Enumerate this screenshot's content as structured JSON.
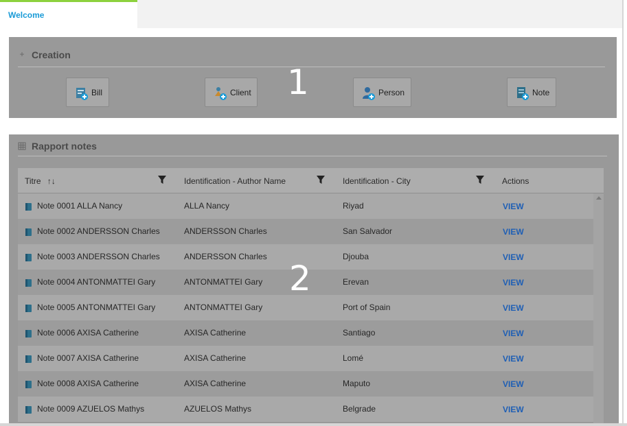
{
  "tabs": [
    {
      "label": "Welcome",
      "active": true
    }
  ],
  "creation": {
    "title": "Creation",
    "buttons": [
      {
        "label": "Bill",
        "icon": "bill-add-icon"
      },
      {
        "label": "Client",
        "icon": "client-add-icon"
      },
      {
        "label": "Person",
        "icon": "person-add-icon"
      },
      {
        "label": "Note",
        "icon": "note-add-icon"
      }
    ]
  },
  "annotations": {
    "one": "1",
    "two": "2"
  },
  "rapport": {
    "title": "Rapport notes",
    "columns": [
      {
        "label": "Titre",
        "sort_icon": "↑↓",
        "filter": true
      },
      {
        "label": "Identification - Author Name",
        "filter": true
      },
      {
        "label": "Identification - City",
        "filter": true
      },
      {
        "label": "Actions",
        "filter": false
      }
    ],
    "rows": [
      {
        "titre": "Note 0001 ALLA Nancy",
        "author": "ALLA Nancy",
        "city": "Riyad",
        "action": "VIEW"
      },
      {
        "titre": "Note 0002 ANDERSSON Charles",
        "author": "ANDERSSON Charles",
        "city": "San Salvador",
        "action": "VIEW"
      },
      {
        "titre": "Note 0003 ANDERSSON Charles",
        "author": "ANDERSSON Charles",
        "city": "Djouba",
        "action": "VIEW"
      },
      {
        "titre": "Note 0004 ANTONMATTEI Gary",
        "author": "ANTONMATTEI Gary",
        "city": "Erevan",
        "action": "VIEW"
      },
      {
        "titre": "Note 0005 ANTONMATTEI Gary",
        "author": "ANTONMATTEI Gary",
        "city": "Port of Spain",
        "action": "VIEW"
      },
      {
        "titre": "Note 0006 AXISA Catherine",
        "author": "AXISA Catherine",
        "city": "Santiago",
        "action": "VIEW"
      },
      {
        "titre": "Note 0007 AXISA Catherine",
        "author": "AXISA Catherine",
        "city": "Lomé",
        "action": "VIEW"
      },
      {
        "titre": "Note 0008 AXISA Catherine",
        "author": "AXISA Catherine",
        "city": "Maputo",
        "action": "VIEW"
      },
      {
        "titre": "Note 0009 AZUELOS Mathys",
        "author": "AZUELOS Mathys",
        "city": "Belgrade",
        "action": "VIEW"
      }
    ]
  },
  "colors": {
    "accent": "#1a9bd7",
    "tab_indicator": "#8dd13e",
    "link": "#1f5fb5"
  }
}
